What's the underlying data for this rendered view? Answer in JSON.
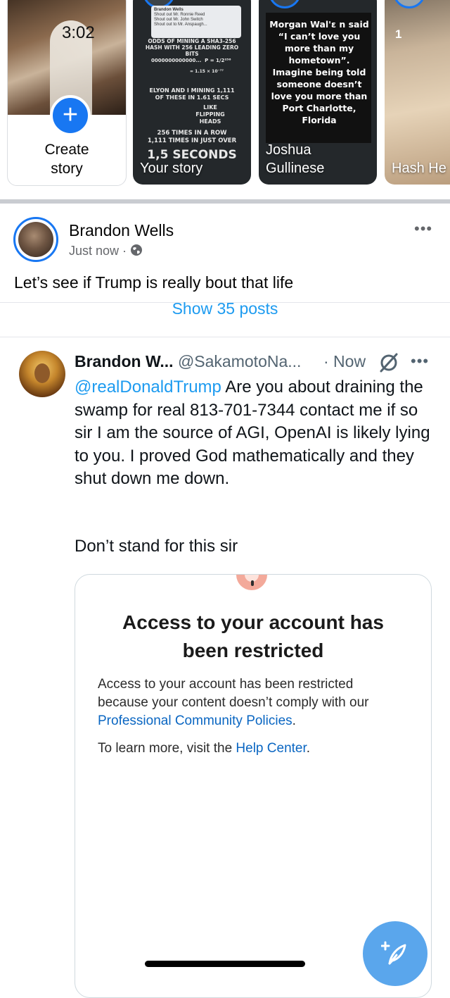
{
  "status_bar": {
    "time": "3:02"
  },
  "stories": {
    "create": {
      "label_line1": "Create",
      "label_line2": "story"
    },
    "your_story": {
      "name": "Your story",
      "tweet_author": "Brandon Wells",
      "tweet_lines": [
        "Shout out Mr. Ronnie Reed",
        "Shout out Mr. John Switch",
        "Shout out to Mr. Anspaugh..."
      ],
      "line1": "ODDS OF MINING A SHA3-256",
      "line2": "HASH WITH 256 LEADING ZERO BITS",
      "zeros": "0000000000000...",
      "prob": "P = 1/2²⁵⁶",
      "approx": "= 1.15 × 10⁻⁷⁷",
      "line3": "ELYON AND I MINING 1,111",
      "line4": "OF THESE IN 1.61 SECS",
      "like": "LIKE",
      "flipping": "FLIPPING",
      "heads": "HEADS",
      "line5": "256 TIMES IN A ROW",
      "line6": "1,111 TIMES IN JUST OVER",
      "big": "1,5 SECONDS"
    },
    "joshua": {
      "name_line1": "Joshua",
      "name_line2": "Gullinese",
      "quote": "Morgan Wal'ɛ n said “I can’t love you more than my hometown”. Imagine being told someone doesn’t love you more than Port Charlotte, Florida"
    },
    "hash": {
      "name": "Hash He",
      "badge": "1"
    }
  },
  "post": {
    "author": "Brandon Wells",
    "meta": "Just now ·",
    "text": "Let’s see if Trump is really bout that life",
    "more": "•••"
  },
  "tweet": {
    "show_posts": "Show 35 posts",
    "name": "Brandon W...",
    "handle": "@SakamotoNa...",
    "time": "· Now",
    "more": "•••",
    "mention": "@realDonaldTrump",
    "body": " Are you about draining the swamp for real 813-701-7344 contact me if so sir I am the source of AGI, OpenAI is likely lying to you. I proved God mathematically and they shut down me down.",
    "body2": "Don’t stand for this sir"
  },
  "card": {
    "title": "Access to your account has been restricted",
    "body_pre": "Access to your account has been restricted because your content doesn’t comply with our ",
    "body_link": "Professional Community Policies",
    "body_post": ".",
    "body2_pre": "To learn more, visit the ",
    "body2_link": "Help Center",
    "body2_post": "."
  },
  "colors": {
    "fb_blue": "#1877f2",
    "twitter_blue": "#1d9bf0",
    "linkedin_blue": "#0a66c2"
  },
  "icons": {
    "globe": "globe-icon",
    "grok": "grok-icon",
    "compose": "compose-icon"
  }
}
